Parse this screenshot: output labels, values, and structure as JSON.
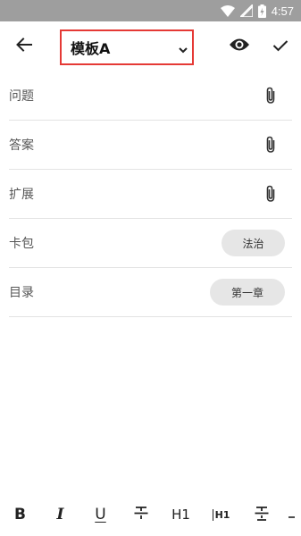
{
  "status_bar": {
    "time": "4:57",
    "icons": [
      "wifi-icon",
      "signal-icon",
      "battery-charging-icon"
    ]
  },
  "toolbar": {
    "back_icon": "arrow-back-icon",
    "template_label": "模板A",
    "dropdown_icon": "chevron-down-icon",
    "preview_icon": "eye-icon",
    "confirm_icon": "check-icon"
  },
  "fields": {
    "question_label": "问题",
    "answer_label": "答案",
    "extension_label": "扩展",
    "attach_icon": "paperclip-icon"
  },
  "card_pack": {
    "label": "卡包",
    "value": "法治"
  },
  "catalog": {
    "label": "目录",
    "value": "第一章"
  },
  "format_bar": {
    "bold": "B",
    "italic": "I",
    "underline": "U",
    "h1": "H1",
    "h1_small": "H1"
  },
  "colors": {
    "highlight_border": "#e53935",
    "status_bar": "#9e9e9e",
    "chip_bg": "#e6e6e6",
    "divider": "#e3e3e3"
  }
}
